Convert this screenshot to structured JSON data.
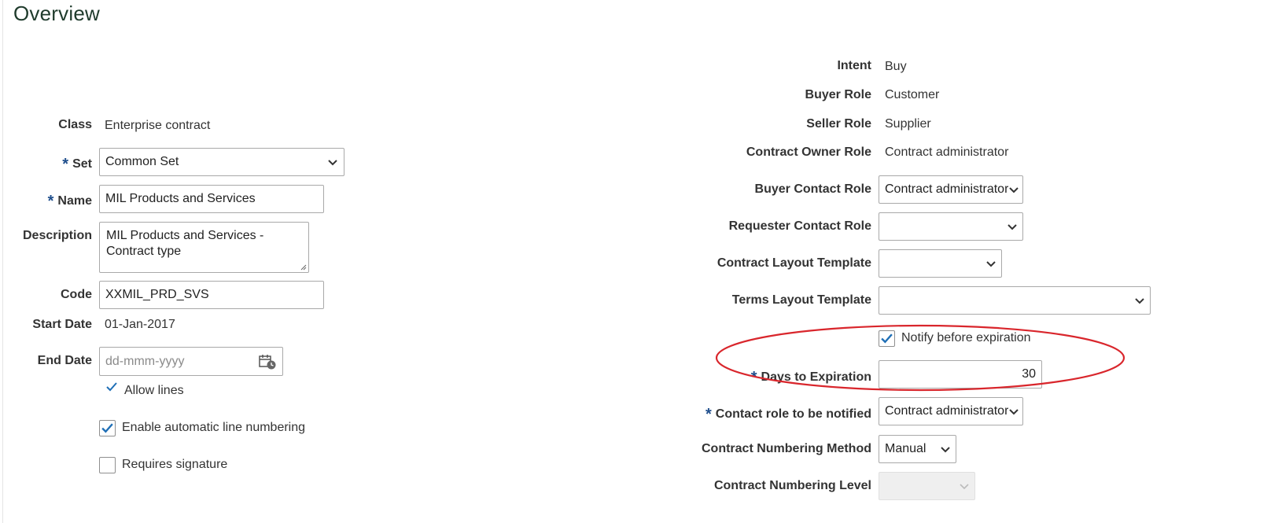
{
  "page": {
    "title": "Overview"
  },
  "left": {
    "class": {
      "label": "Class",
      "value": "Enterprise contract"
    },
    "set": {
      "label": "Set",
      "required_mark": "*",
      "value": "Common Set"
    },
    "name": {
      "label": "Name",
      "required_mark": "*",
      "value": "MIL Products and Services"
    },
    "description": {
      "label": "Description",
      "value": "MIL Products and Services - Contract type"
    },
    "code": {
      "label": "Code",
      "value": "XXMIL_PRD_SVS"
    },
    "start_date": {
      "label": "Start Date",
      "value": "01-Jan-2017"
    },
    "end_date": {
      "label": "End Date",
      "placeholder": "dd-mmm-yyyy"
    },
    "allow_lines": {
      "label": "Allow lines",
      "checked": true
    },
    "auto_line_numbering": {
      "label": "Enable automatic line numbering",
      "checked": true
    },
    "requires_signature": {
      "label": "Requires signature",
      "checked": false
    }
  },
  "right": {
    "intent": {
      "label": "Intent",
      "value": "Buy"
    },
    "buyer_role": {
      "label": "Buyer Role",
      "value": "Customer"
    },
    "seller_role": {
      "label": "Seller Role",
      "value": "Supplier"
    },
    "contract_owner_role": {
      "label": "Contract Owner Role",
      "value": "Contract administrator"
    },
    "buyer_contact_role": {
      "label": "Buyer Contact Role",
      "value": "Contract administrator"
    },
    "requester_contact_role": {
      "label": "Requester Contact Role",
      "value": ""
    },
    "contract_layout_template": {
      "label": "Contract Layout Template",
      "value": ""
    },
    "terms_layout_template": {
      "label": "Terms Layout Template",
      "value": ""
    },
    "notify_before_expiration": {
      "label": "Notify before expiration",
      "checked": true
    },
    "days_to_expiration": {
      "label": "Days to Expiration",
      "required_mark": "*",
      "value": "30"
    },
    "contact_role_notified": {
      "label": "Contact role to be notified",
      "required_mark": "*",
      "value": "Contract administrator"
    },
    "numbering_method": {
      "label": "Contract Numbering Method",
      "value": "Manual"
    },
    "numbering_level": {
      "label": "Contract Numbering Level",
      "value": ""
    }
  },
  "colors": {
    "title": "#1f3b2c",
    "required": "#1f4e8c",
    "checkbox_check": "#1f6fb6",
    "annotation_ellipse": "#d9262c"
  },
  "icons": {
    "calendar": "calendar-icon",
    "dropdown": "chevron-down-icon",
    "check": "checkmark-icon",
    "resize": "resize-grip-icon"
  }
}
